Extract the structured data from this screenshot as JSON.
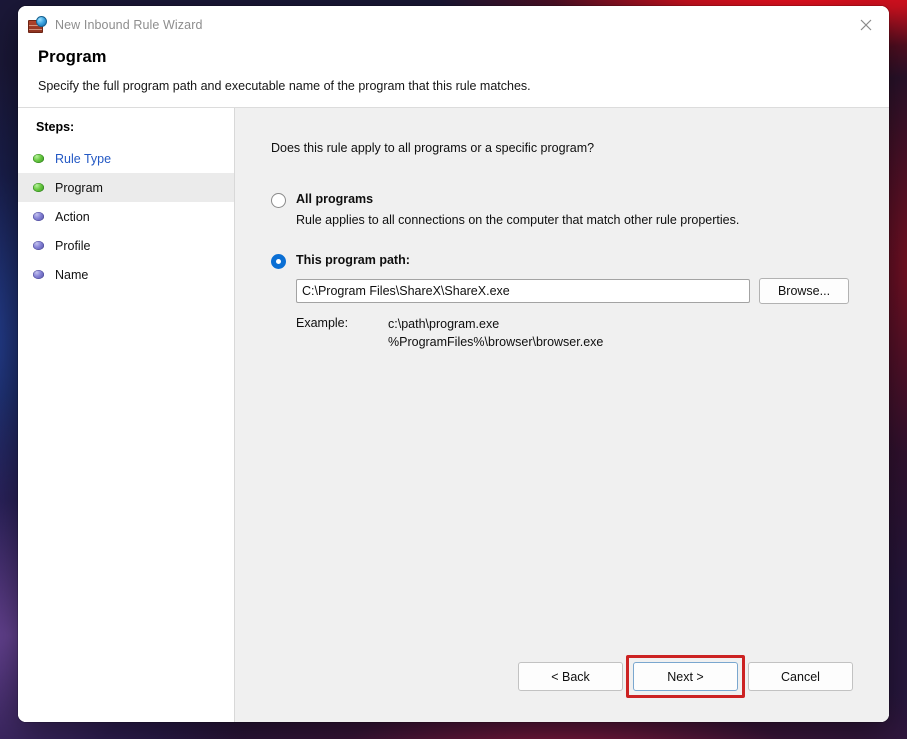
{
  "window": {
    "title": "New Inbound Rule Wizard",
    "title_icon": "firewall-globe-icon",
    "close_icon": "close-icon"
  },
  "header": {
    "title": "Program",
    "subtitle": "Specify the full program path and executable name of the program that this rule matches."
  },
  "steps": {
    "title": "Steps:",
    "items": [
      {
        "label": "Rule Type",
        "bullet": "green",
        "state": "completed-link"
      },
      {
        "label": "Program",
        "bullet": "green",
        "state": "current"
      },
      {
        "label": "Action",
        "bullet": "blue",
        "state": "pending"
      },
      {
        "label": "Profile",
        "bullet": "blue",
        "state": "pending"
      },
      {
        "label": "Name",
        "bullet": "blue",
        "state": "pending"
      }
    ]
  },
  "main": {
    "question": "Does this rule apply to all programs or a specific program?",
    "options": [
      {
        "label": "All programs",
        "description": "Rule applies to all connections on the computer that match other rule properties.",
        "selected": false
      },
      {
        "label": "This program path:",
        "selected": true
      }
    ],
    "path_input": {
      "value": "C:\\Program Files\\ShareX\\ShareX.exe",
      "placeholder": ""
    },
    "browse_label": "Browse...",
    "example": {
      "label": "Example:",
      "line1": "c:\\path\\program.exe",
      "line2": "%ProgramFiles%\\browser\\browser.exe"
    }
  },
  "footer": {
    "back_label": "< Back",
    "next_label": "Next >",
    "cancel_label": "Cancel"
  },
  "colors": {
    "accent_blue": "#0b6fd4",
    "link_blue": "#2358c4",
    "highlight_red": "#cc2222",
    "step_done_green": "#69c842",
    "step_pending_blue": "#8582d6"
  }
}
